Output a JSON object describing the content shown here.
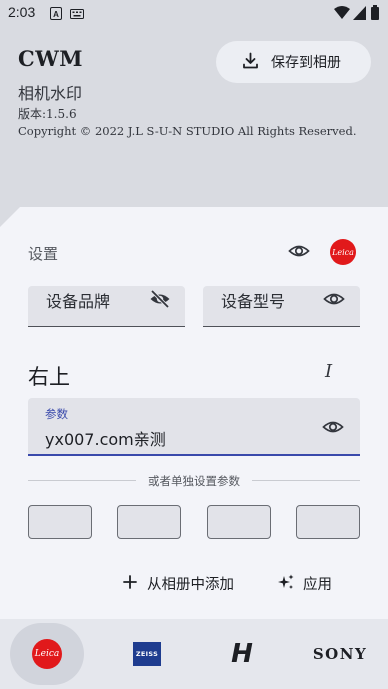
{
  "status_bar": {
    "time": "2:03",
    "icons": [
      "notification-a-icon",
      "keyboard-icon",
      "wifi-icon",
      "signal-icon",
      "battery-icon"
    ]
  },
  "header": {
    "title": "CWM",
    "subtitle": "相机水印",
    "version": "版本:1.5.6",
    "copyright": "Copyright © 2022 J.L S-U-N STUDIO All Rights Reserved.",
    "save_button": "保存到相册"
  },
  "settings": {
    "heading": "设置",
    "brand_field": "设备品牌",
    "model_field": "设备型号",
    "position_title": "右上",
    "param_label": "参数",
    "param_value": "yx007.com亲测",
    "divider_text": "或者单独设置参数",
    "add_from_album": "从相册中添加",
    "apply": "应用",
    "leica_badge": "Leica"
  },
  "brands": {
    "leica": "Leica",
    "zeiss": "ZEISS",
    "hasselblad": "H",
    "sony": "SONY",
    "selected": "leica"
  },
  "colors": {
    "accent": "#3949ab",
    "leica_red": "#e1191b",
    "zeiss_blue": "#1e3c8f",
    "background": "#d9dbe1",
    "card": "#f3f4f9"
  }
}
